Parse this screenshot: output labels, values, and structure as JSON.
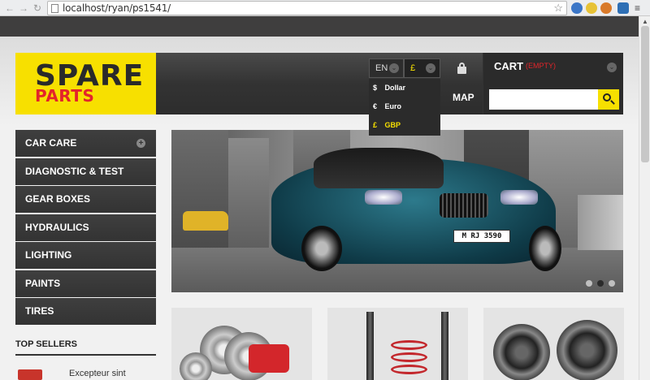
{
  "browser": {
    "url": "localhost/ryan/ps1541/",
    "back_glyph": "←",
    "forward_glyph": "→",
    "reload_glyph": "↻",
    "star_glyph": "☆",
    "scroll_up_glyph": "▲"
  },
  "logo": {
    "line1": "SPARE",
    "line2": "PARTS"
  },
  "header": {
    "language": "EN",
    "currency": "£",
    "chevron_glyph": "⌄",
    "nav_partial": "MAP",
    "cart_label": "CART",
    "cart_status": "(EMPTY)"
  },
  "currency_menu": {
    "items": [
      {
        "symbol": "$",
        "label": "Dollar"
      },
      {
        "symbol": "€",
        "label": "Euro"
      },
      {
        "symbol": "£",
        "label": "GBP"
      }
    ],
    "selected": "GBP"
  },
  "categories": {
    "items": [
      {
        "label": "CAR CARE",
        "expand": "+"
      },
      {
        "label": "DIAGNOSTIC & TEST"
      },
      {
        "label": "GEAR BOXES"
      },
      {
        "label": "HYDRAULICS"
      },
      {
        "label": "LIGHTING"
      },
      {
        "label": "PAINTS"
      },
      {
        "label": "TIRES"
      }
    ]
  },
  "top_sellers": {
    "title": "TOP SELLERS",
    "first_item": "Excepteur sint"
  },
  "banner": {
    "plate": "M RJ 3590",
    "active_slide": 2,
    "slide_count": 3
  },
  "colors": {
    "accent_yellow": "#f7e000",
    "accent_red": "#e3242b",
    "dark": "#333333"
  },
  "icons": [
    "page-icon",
    "bookmark-star-icon",
    "lock-icon",
    "search-icon",
    "chevron-down-icon",
    "plus-circle-icon"
  ]
}
